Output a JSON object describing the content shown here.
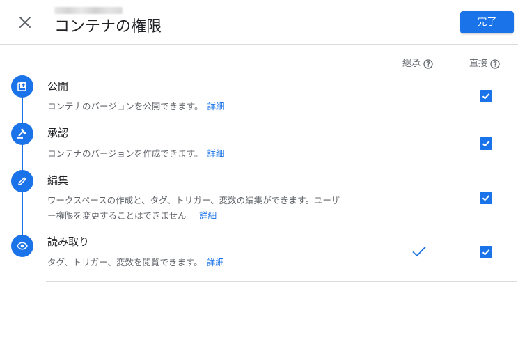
{
  "header": {
    "title": "コンテナの権限",
    "done_label": "完了",
    "close_icon": "close-icon"
  },
  "columns": {
    "inherited": "継承",
    "direct": "直接"
  },
  "roles": [
    {
      "title": "公開",
      "description": "コンテナのバージョンを公開できます。",
      "link": "詳細",
      "icon": "publish-icon",
      "inherited": false,
      "direct": true
    },
    {
      "title": "承認",
      "description": "コンテナのバージョンを作成できます。",
      "link": "詳細",
      "icon": "gavel-icon",
      "inherited": false,
      "direct": true
    },
    {
      "title": "編集",
      "description_line1": "ワークスペースの作成と、タグ、トリガー、変数の編集ができます。ユーザ",
      "description_line2": "ー権限を変更することはできません。",
      "link": "詳細",
      "icon": "pencil-icon",
      "inherited": false,
      "direct": true
    },
    {
      "title": "読み取り",
      "description": "タグ、トリガー、変数を閲覧できます。",
      "link": "詳細",
      "icon": "eye-icon",
      "inherited": true,
      "direct": true
    }
  ],
  "colors": {
    "accent": "#1a73e8",
    "divider": "#dadce0",
    "secondary_text": "#5f6368"
  }
}
